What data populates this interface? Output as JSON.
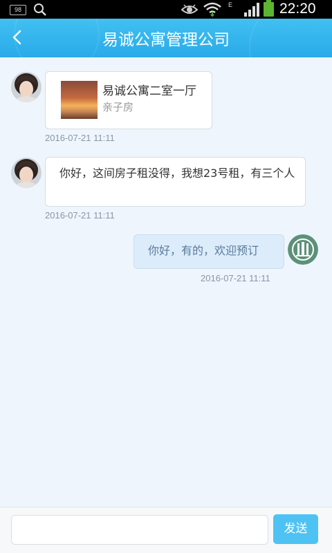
{
  "status_bar": {
    "badge": "98",
    "network": "E",
    "time": "22:20"
  },
  "header": {
    "title": "易诚公寓管理公司",
    "accent": "#35b5ee"
  },
  "messages": [
    {
      "type": "card",
      "direction": "in",
      "card_title": "易诚公寓二室一厅",
      "card_subtitle": "亲子房",
      "timestamp": "2016-07-21 11:11"
    },
    {
      "type": "text",
      "direction": "in",
      "text": "你好，这间房子租没得，我想23号租，有三个人",
      "timestamp": "2016-07-21 11:11"
    },
    {
      "type": "text",
      "direction": "out",
      "text": "你好，有的，欢迎预订",
      "timestamp": "2016-07-21 11:11"
    }
  ],
  "input_bar": {
    "placeholder": "",
    "send_label": "发送"
  }
}
